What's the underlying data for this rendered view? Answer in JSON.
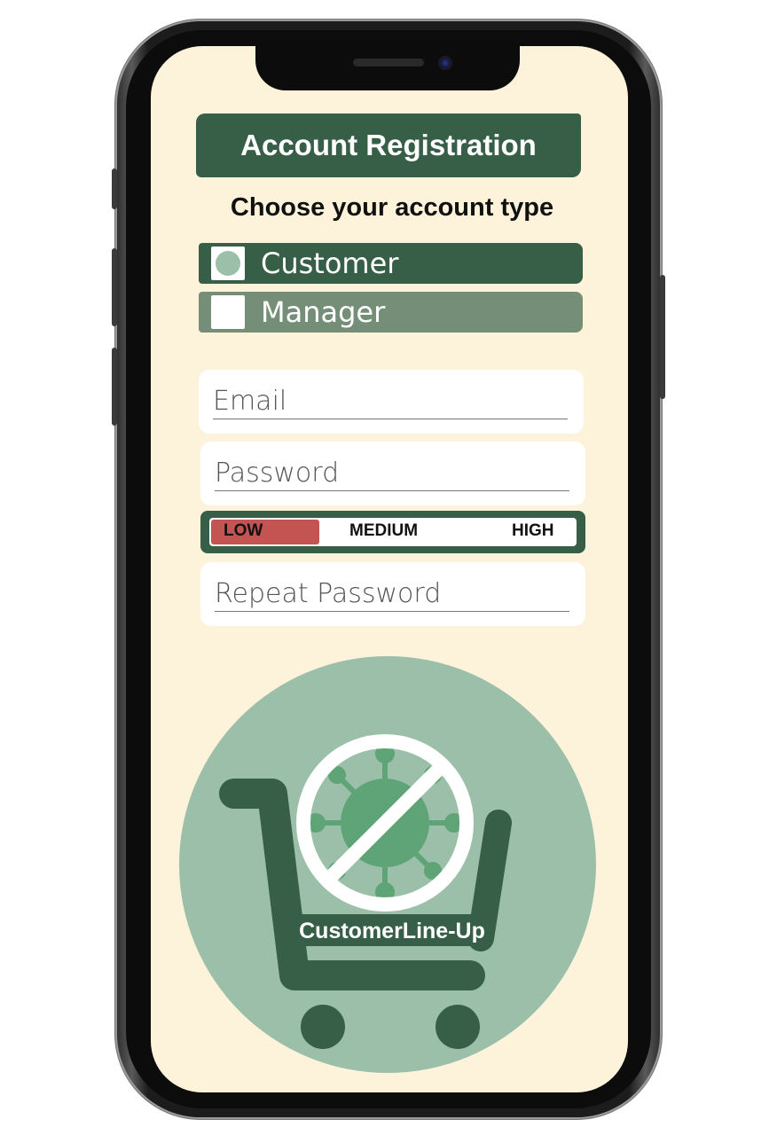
{
  "header": {
    "title": "Account Registration"
  },
  "account_type": {
    "prompt": "Choose your account type",
    "options": [
      {
        "label": "Customer",
        "selected": true
      },
      {
        "label": "Manager",
        "selected": false
      }
    ]
  },
  "form": {
    "email_placeholder": "Email",
    "password_placeholder": "Password",
    "repeat_password_placeholder": "Repeat Password"
  },
  "password_strength": {
    "levels": [
      "LOW",
      "MEDIUM",
      "HIGH"
    ],
    "current": "LOW",
    "low_color": "#c35452"
  },
  "logo": {
    "text": "CustomerLine-Up"
  },
  "colors": {
    "primary": "#375e47",
    "secondary": "#758e77",
    "background": "#fdf3da",
    "logo_circle": "#9bbfa9",
    "virus": "#5fa476"
  }
}
